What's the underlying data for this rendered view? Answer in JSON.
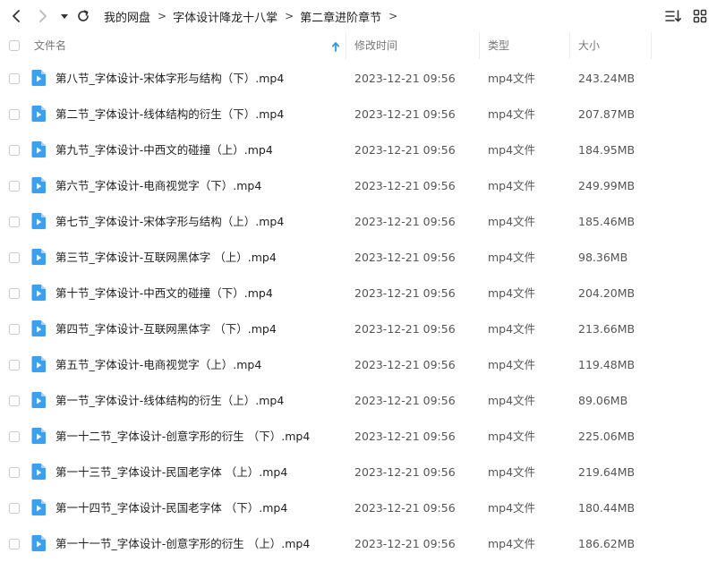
{
  "breadcrumb": [
    "我的网盘",
    "字体设计降龙十八掌",
    "第二章进阶章节"
  ],
  "columns": {
    "name": "文件名",
    "modified": "修改时间",
    "type": "类型",
    "size": "大小"
  },
  "files": [
    {
      "name": "第八节_字体设计-宋体字形与结构（下）.mp4",
      "modified": "2023-12-21 09:56",
      "type": "mp4文件",
      "size": "243.24MB"
    },
    {
      "name": "第二节_字体设计-线体结构的衍生（下）.mp4",
      "modified": "2023-12-21 09:56",
      "type": "mp4文件",
      "size": "207.87MB"
    },
    {
      "name": "第九节_字体设计-中西文的碰撞（上）.mp4",
      "modified": "2023-12-21 09:56",
      "type": "mp4文件",
      "size": "184.95MB"
    },
    {
      "name": "第六节_字体设计-电商视觉字（下）.mp4",
      "modified": "2023-12-21 09:56",
      "type": "mp4文件",
      "size": "249.99MB"
    },
    {
      "name": "第七节_字体设计-宋体字形与结构（上）.mp4",
      "modified": "2023-12-21 09:56",
      "type": "mp4文件",
      "size": "185.46MB"
    },
    {
      "name": "第三节_字体设计-互联网黑体字 （上）.mp4",
      "modified": "2023-12-21 09:56",
      "type": "mp4文件",
      "size": "98.36MB"
    },
    {
      "name": "第十节_字体设计-中西文的碰撞（下）.mp4",
      "modified": "2023-12-21 09:56",
      "type": "mp4文件",
      "size": "204.20MB"
    },
    {
      "name": "第四节_字体设计-互联网黑体字 （下）.mp4",
      "modified": "2023-12-21 09:56",
      "type": "mp4文件",
      "size": "213.66MB"
    },
    {
      "name": "第五节_字体设计-电商视觉字（上）.mp4",
      "modified": "2023-12-21 09:56",
      "type": "mp4文件",
      "size": "119.48MB"
    },
    {
      "name": "第一节_字体设计-线体结构的衍生（上）.mp4",
      "modified": "2023-12-21 09:56",
      "type": "mp4文件",
      "size": "89.06MB"
    },
    {
      "name": "第一十二节_字体设计-创意字形的衍生 （下）.mp4",
      "modified": "2023-12-21 09:56",
      "type": "mp4文件",
      "size": "225.06MB"
    },
    {
      "name": "第一十三节_字体设计-民国老字体 （上）.mp4",
      "modified": "2023-12-21 09:56",
      "type": "mp4文件",
      "size": "219.64MB"
    },
    {
      "name": "第一十四节_字体设计-民国老字体 （下）.mp4",
      "modified": "2023-12-21 09:56",
      "type": "mp4文件",
      "size": "180.44MB"
    },
    {
      "name": "第一十一节_字体设计-创意字形的衍生 （上）.mp4",
      "modified": "2023-12-21 09:56",
      "type": "mp4文件",
      "size": "186.62MB"
    }
  ],
  "colors": {
    "accent": "#2f9bea",
    "icon": "#3d9ff0",
    "text": "#222222",
    "muted": "#777777"
  },
  "icons": {
    "back": "chevron-left-icon",
    "forward": "chevron-right-icon",
    "history": "caret-down-icon",
    "refresh": "refresh-icon",
    "sort": "sort-icon",
    "grid": "grid-view-icon",
    "file": "video-file-icon"
  }
}
